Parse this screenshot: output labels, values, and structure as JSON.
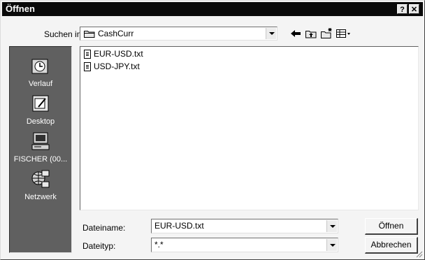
{
  "window": {
    "title": "Öffnen",
    "help_label": "?",
    "close_label": "✕"
  },
  "lookin": {
    "label": "Suchen in:",
    "value": "CashCurr"
  },
  "toolbar": {
    "back_icon": "back-arrow-icon",
    "up_icon": "up-folder-icon",
    "new_folder_icon": "new-folder-icon",
    "view_icon": "view-menu-icon"
  },
  "places": [
    {
      "label": "Verlauf",
      "icon": "history-icon"
    },
    {
      "label": "Desktop",
      "icon": "desktop-icon"
    },
    {
      "label": "FISCHER (00...",
      "icon": "my-computer-icon"
    },
    {
      "label": "Netzwerk",
      "icon": "network-icon"
    }
  ],
  "files": [
    {
      "name": "EUR-USD.txt",
      "icon": "text-file-icon"
    },
    {
      "name": "USD-JPY.txt",
      "icon": "text-file-icon"
    }
  ],
  "filename": {
    "label": "Dateiname:",
    "value": "EUR-USD.txt"
  },
  "filetype": {
    "label": "Dateityp:",
    "value": "*.*"
  },
  "buttons": {
    "open": "Öffnen",
    "cancel": "Abbrechen"
  }
}
